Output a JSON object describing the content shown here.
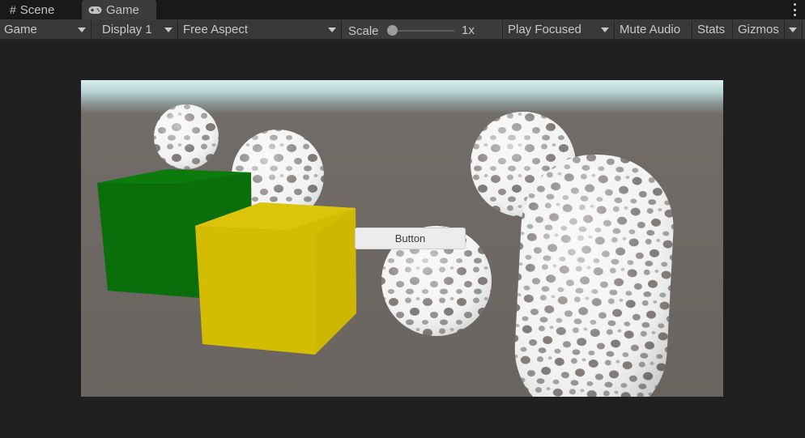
{
  "tabs": [
    {
      "label": "Scene",
      "icon": "grid-icon",
      "active": false
    },
    {
      "label": "Game",
      "icon": "gamepad-icon",
      "active": true
    }
  ],
  "toolbar": {
    "view_mode": "Game",
    "display": "Display 1",
    "aspect": "Free Aspect",
    "scale_label": "Scale",
    "scale_value": "1x",
    "play_mode": "Play Focused",
    "mute_audio": "Mute Audio",
    "stats": "Stats",
    "gizmos": "Gizmos"
  },
  "scene": {
    "button_label": "Button",
    "objects": [
      "sphere",
      "sphere",
      "sphere",
      "sphere",
      "green-cube",
      "yellow-cube",
      "capsule"
    ]
  },
  "colors": {
    "editor_bg": "#282828",
    "toolbar_bg": "#3c3c3c",
    "ground": "#6a6461",
    "sky": "#d7eeee",
    "green_cube": "#0a6f0a",
    "yellow_cube": "#d4bd00"
  }
}
